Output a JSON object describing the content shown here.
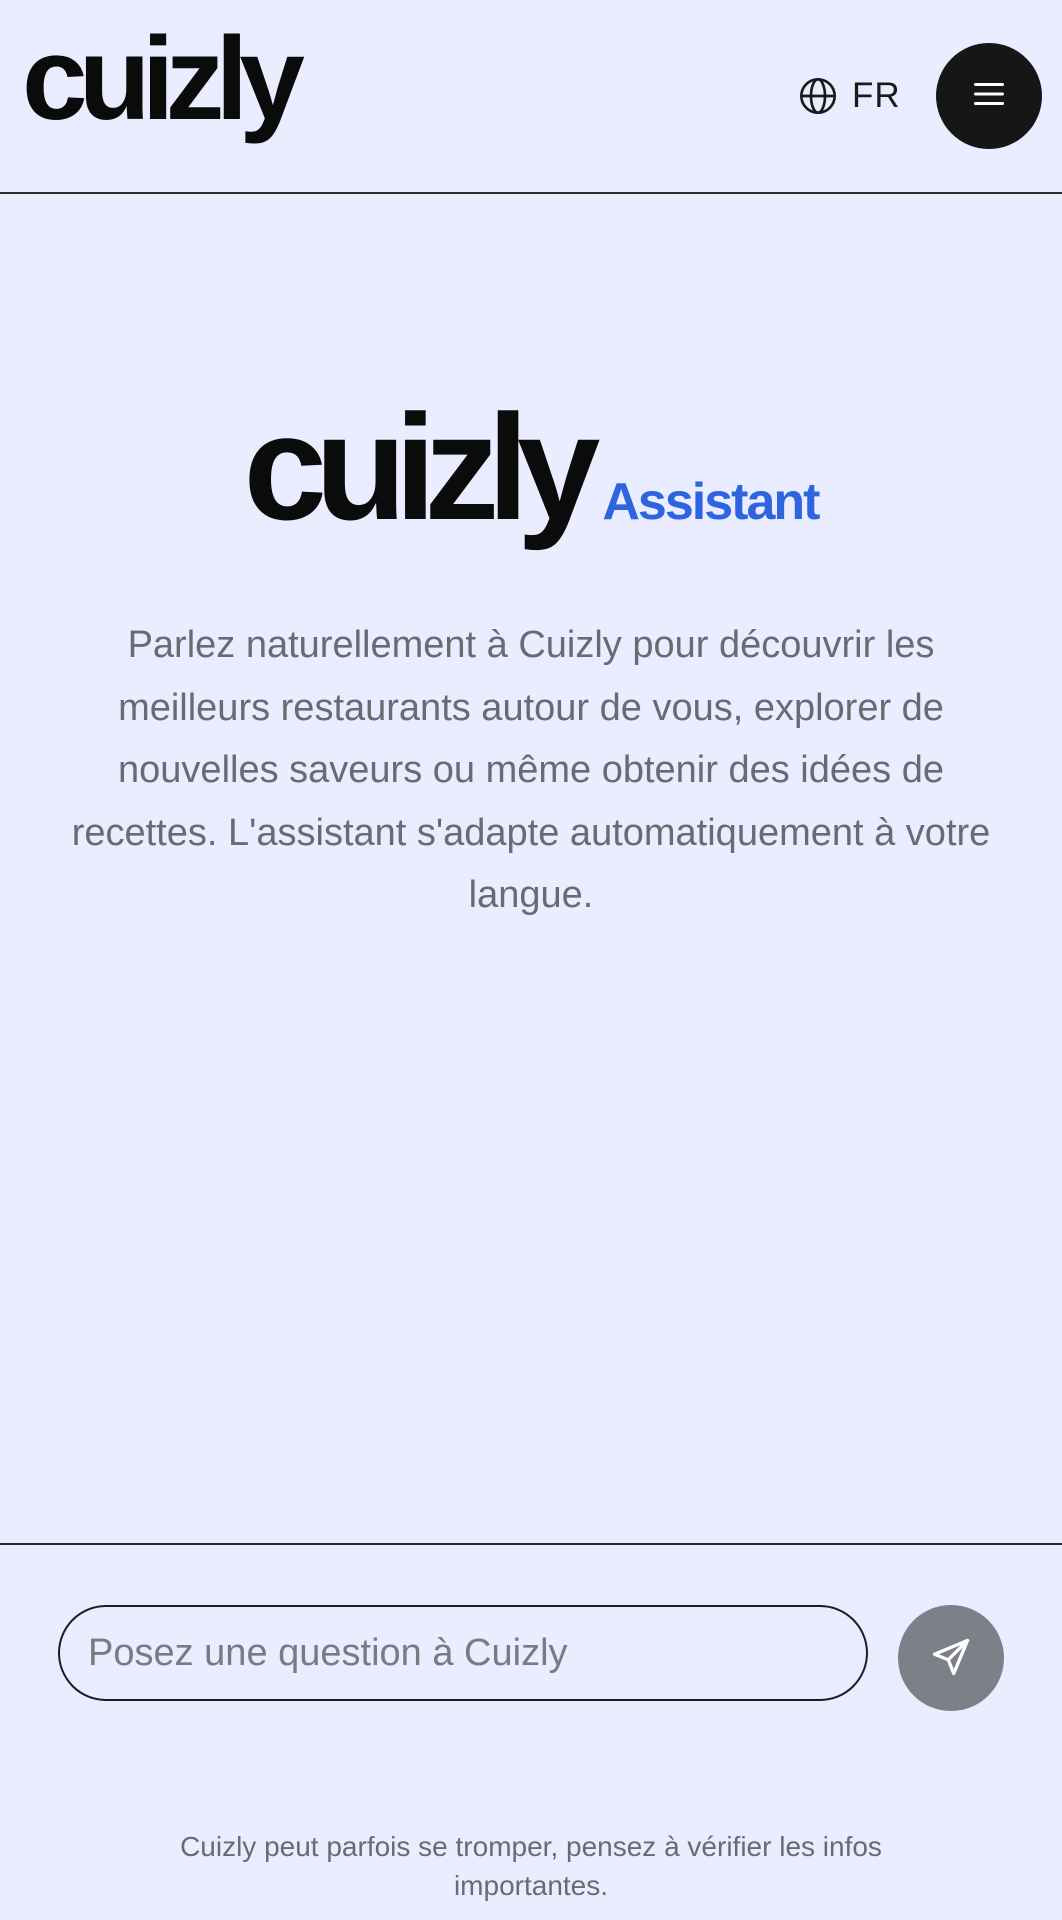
{
  "header": {
    "logo_text": "cuizly",
    "language": {
      "icon": "globe-icon",
      "label": "FR"
    },
    "menu_icon": "hamburger-menu-icon"
  },
  "hero": {
    "brand": "cuizly",
    "product": "Assistant",
    "description": "Parlez naturellement à Cuizly pour découvrir les meilleurs restaurants autour de vous, explorer de nouvelles saveurs ou même obtenir des idées de recettes. L'assistant s'adapte automatiquement à votre langue."
  },
  "composer": {
    "input_value": "",
    "input_placeholder": "Posez une question à Cuizly",
    "send_icon": "send-paper-plane-icon",
    "disclaimer": "Cuizly peut parfois se tromper, pensez à vérifier les infos importantes."
  },
  "colors": {
    "background": "#eaedff",
    "brand_text": "#0b0b0b",
    "accent": "#2f64e0",
    "menu_button": "#161616",
    "send_button": "#7e8089",
    "muted_text": "#6a6a72"
  }
}
